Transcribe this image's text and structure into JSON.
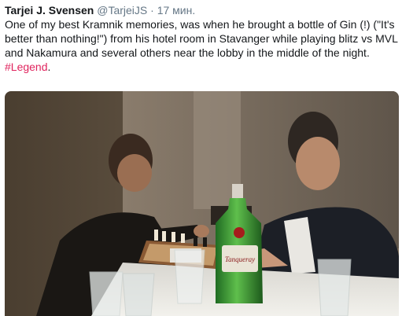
{
  "tweet": {
    "display_name": "Tarjei J. Svensen",
    "handle": "@TarjeiJS",
    "separator": "·",
    "time": "17 мин.",
    "text": "One of my best Kramnik memories, was when he brought a bottle of Gin (!) (\"It's better than nothing!\") from his hotel room in Stavanger while playing blitz vs MVL and Nakamura and several others near the lobby in the middle of the night.",
    "hashtag": "#Legend",
    "period": "."
  },
  "colors": {
    "text": "#14171a",
    "secondary": "#657786",
    "hashtag": "#e0245e"
  },
  "media": {
    "bottle_label": "Tanqueray"
  }
}
